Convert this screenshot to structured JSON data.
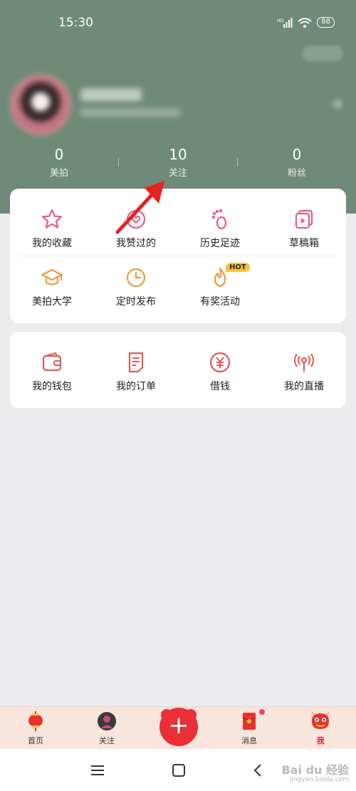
{
  "status_bar": {
    "time": "15:30",
    "battery": "88",
    "network": "HD"
  },
  "stats": [
    {
      "value": "0",
      "label": "美拍"
    },
    {
      "value": "10",
      "label": "关注"
    },
    {
      "value": "0",
      "label": "粉丝"
    }
  ],
  "menu_grid": [
    {
      "label": "我的收藏",
      "icon": "star-icon"
    },
    {
      "label": "我赞过的",
      "icon": "liked-icon"
    },
    {
      "label": "历史足迹",
      "icon": "footprint-icon"
    },
    {
      "label": "草稿箱",
      "icon": "drafts-icon"
    },
    {
      "label": "美拍大学",
      "icon": "graduation-cap-icon"
    },
    {
      "label": "定时发布",
      "icon": "clock-icon"
    },
    {
      "label": "有奖活动",
      "icon": "flame-icon",
      "badge": "HOT"
    }
  ],
  "services": [
    {
      "label": "我的钱包",
      "icon": "wallet-icon"
    },
    {
      "label": "我的订单",
      "icon": "order-icon"
    },
    {
      "label": "借钱",
      "icon": "yuan-icon"
    },
    {
      "label": "我的直播",
      "icon": "broadcast-icon"
    }
  ],
  "tabbar": [
    {
      "label": "首页",
      "icon": "lantern-icon"
    },
    {
      "label": "关注",
      "icon": "avatar-icon"
    },
    {
      "label": "",
      "icon": "plus-icon"
    },
    {
      "label": "消息",
      "icon": "red-envelope-icon"
    },
    {
      "label": "我",
      "icon": "lion-dance-icon",
      "active": true
    }
  ],
  "watermark": {
    "text": "Bai du 经验",
    "sub": "jingyan.baidu.com"
  },
  "colors": {
    "header_bg": "#6f8a78",
    "accent_red": "#ea2f36",
    "pink": "#e85a8c",
    "orange": "#f09a3e",
    "red_icon": "#e25b57"
  }
}
